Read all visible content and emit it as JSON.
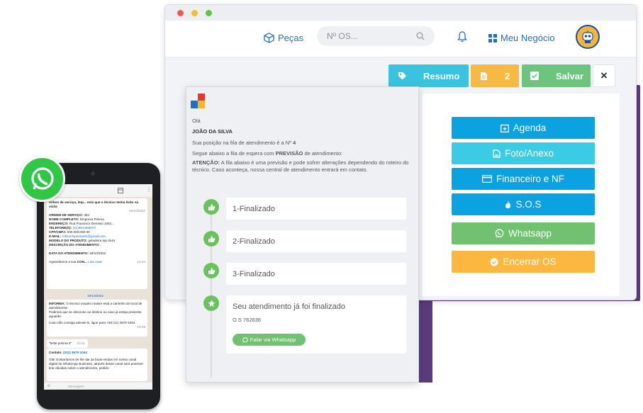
{
  "navbar": {
    "pecas": "Peças",
    "search_placeholder": "Nº OS...",
    "meu_negocio": "Meu Negócio"
  },
  "toolbar": {
    "resumo": "Resumo",
    "count": "2",
    "salvar": "Salvar",
    "close": "×"
  },
  "actions": {
    "agenda": "Agenda",
    "foto": "Foto/Anexo",
    "financeiro": "Financeiro e NF",
    "sos": "S.O.S",
    "whatsapp": "Whatsapp",
    "encerrar": "Encerrar OS"
  },
  "colors": {
    "blue_btn": "#0aa2e0",
    "cyan_btn": "#3ccbe4",
    "green_btn": "#71c270",
    "orange_btn": "#fbb73f",
    "backdrop": "#5b3b7e"
  },
  "panel": {
    "greeting": "Olá",
    "name": "JOÃO DA SILVA",
    "queue_prefix": "Sua posição na fila de atendimento é a Nº",
    "queue_number": "4",
    "line_a": "Segue abaixo a fila de espera com",
    "line_b": "PREVISÃO",
    "line_c": "de atendimento:",
    "warn_label": "ATENÇÃO:",
    "warn_text": "A fila abaixo é uma previsão e pode sofrer alterações dependendo do roteiro do técnico. Caso aconteça, nossa central de atendimento entrará em contato.",
    "steps": [
      "1-Finalizado",
      "2-Finalizado",
      "3-Finalizado"
    ],
    "final_title": "Seu atendimento já foi finalizado",
    "final_os": "O.S 762636",
    "final_button": "Falar via Whatsapp"
  },
  "phone": {
    "msg1_head": "ordem de serviço, imp... está que o técnico tenha êxito na visita",
    "msg1_date": "16/10/2022",
    "os_label": "ORDEM DE SERVIÇO:",
    "os_value": "364",
    "nome_label": "NOME COMPLETO:",
    "nome_value": "Empresa Prisma",
    "end_label": "ENDEREÇO:",
    "end_value": "Rua Francisco Derosso 3451...",
    "tel_label": "TELEFONE(S):",
    "tel_value": "(41)991458007/",
    "cpf_label": "CPF/CNPJ:",
    "cpf_value": "000.000.000-00",
    "email_label": "E-MAIL:",
    "email_value": "robsonlopessales@gmail.com",
    "modelo_label": "MODELO DO PRODUTO:",
    "modelo_value": "geladeira top dc4a",
    "desc_label": "DESCRIÇÃO DO ATENDIMENTO:",
    "data_label": "DATA DO ATENDIMENTO:",
    "data_value": "18/10/2022",
    "aguardamos": "Aguardamos a sua",
    "aguardamos_b": "CON...",
    "leia_mais": "Leia mais",
    "time1": "10:44",
    "date_chip": "18/10/2022",
    "msg2_head": "INFORMA:",
    "msg2_text": "O técnico usuario master está a caminho do local de atendimento!",
    "msg2_more": "Pedimos que se direcione ao destino ou caso já esteja presente, aguarde.",
    "msg2_phone": "Caso não consiga atende-lo, ligue para +55 (11) 3670-1044.",
    "time2": "10:28",
    "msg3": "\"teste prisma 3\"",
    "time3": "10:41",
    "contato_label": "Contato:",
    "contato_value": "(011) 3670-1044",
    "msg4": "Olá! Gostaríamos de lhe dar as boas-vindas em nosso canal digital do WhatsApp Business, através desse canal será possível tirar dúvidas sobre o atendimento, pedido",
    "input_placeholder": "Mensagem"
  }
}
